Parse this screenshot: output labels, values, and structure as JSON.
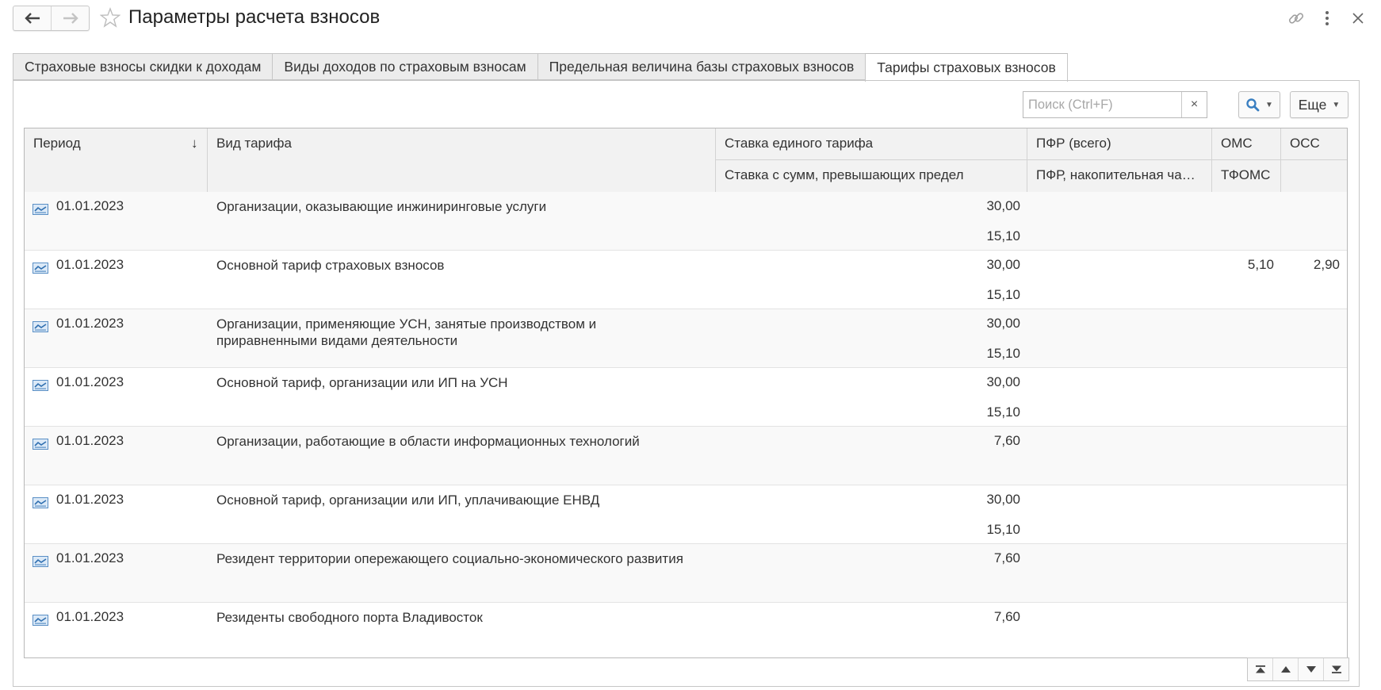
{
  "window": {
    "title": "Параметры расчета взносов"
  },
  "tabs": [
    {
      "label": "Страховые взносы скидки к доходам",
      "active": false
    },
    {
      "label": "Виды доходов по страховым взносам",
      "active": false
    },
    {
      "label": "Предельная величина базы страховых взносов",
      "active": false
    },
    {
      "label": "Тарифы страховых взносов",
      "active": true
    }
  ],
  "toolbar": {
    "search_placeholder": "Поиск (Ctrl+F)",
    "search_value": "",
    "clear_label": "×",
    "more_label": "Еще"
  },
  "columns": {
    "period": "Период",
    "sort_indicator": "↓",
    "tariff_type": "Вид тарифа",
    "unified_rate": "Ставка единого тарифа",
    "over_limit_rate": "Ставка с сумм, превышающих предел",
    "pfr_total": "ПФР (всего)",
    "pfr_funded": "ПФР, накопительная часть",
    "oms": "ОМС",
    "tfoms": "ТФОМС",
    "oss": "ОСС"
  },
  "rows": [
    {
      "period": "01.01.2023",
      "tariff": "Организации, оказывающие инжиниринговые услуги",
      "rate": "30,00",
      "over": "15,10",
      "pfr": "",
      "pfr_funded": "",
      "oms": "",
      "tfoms": "",
      "oss": ""
    },
    {
      "period": "01.01.2023",
      "tariff": "Основной тариф страховых взносов",
      "rate": "30,00",
      "over": "15,10",
      "pfr": "",
      "pfr_funded": "",
      "oms": "5,10",
      "tfoms": "",
      "oss": "2,90"
    },
    {
      "period": "01.01.2023",
      "tariff": "Организации, применяющие УСН, занятые производством и приравненными видами деятельности",
      "rate": "30,00",
      "over": "15,10",
      "pfr": "",
      "pfr_funded": "",
      "oms": "",
      "tfoms": "",
      "oss": ""
    },
    {
      "period": "01.01.2023",
      "tariff": "Основной тариф, организации или ИП на УСН",
      "rate": "30,00",
      "over": "15,10",
      "pfr": "",
      "pfr_funded": "",
      "oms": "",
      "tfoms": "",
      "oss": ""
    },
    {
      "period": "01.01.2023",
      "tariff": "Организации, работающие в области информационных технологий",
      "rate": "7,60",
      "over": "",
      "pfr": "",
      "pfr_funded": "",
      "oms": "",
      "tfoms": "",
      "oss": ""
    },
    {
      "period": "01.01.2023",
      "tariff": "Основной тариф, организации или ИП, уплачивающие ЕНВД",
      "rate": "30,00",
      "over": "15,10",
      "pfr": "",
      "pfr_funded": "",
      "oms": "",
      "tfoms": "",
      "oss": ""
    },
    {
      "period": "01.01.2023",
      "tariff": "Резидент территории опережающего социально-экономического развития",
      "rate": "7,60",
      "over": "",
      "pfr": "",
      "pfr_funded": "",
      "oms": "",
      "tfoms": "",
      "oss": ""
    },
    {
      "period": "01.01.2023",
      "tariff": "Резиденты свободного порта Владивосток",
      "rate": "7,60",
      "over": "",
      "pfr": "",
      "pfr_funded": "",
      "oms": "",
      "tfoms": "",
      "oss": ""
    }
  ],
  "icons": {
    "back": "arrow-left-icon",
    "forward": "arrow-right-icon",
    "favorite": "star-icon",
    "link": "link-icon",
    "menu": "more-vertical-icon",
    "close": "close-icon",
    "search": "search-icon",
    "record": "register-record-icon"
  },
  "colors": {
    "accent_blue": "#3a7fc1",
    "header_bg": "#f2f2f2",
    "alt_row_bg": "#f9f9f9"
  }
}
